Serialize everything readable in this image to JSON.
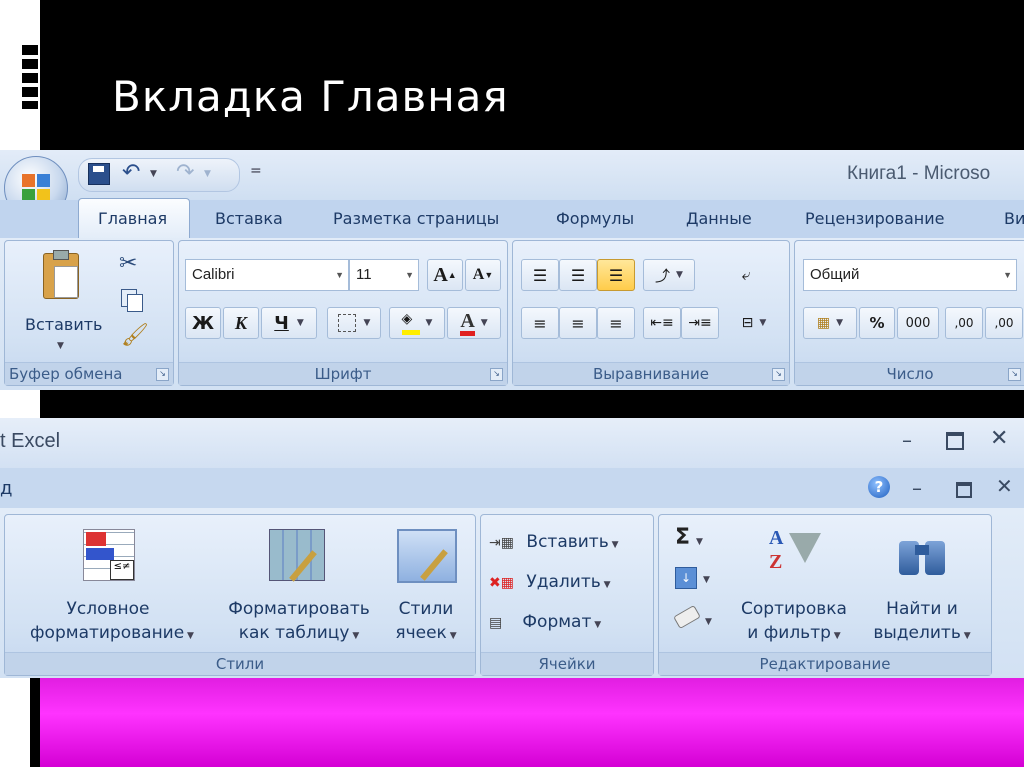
{
  "slide": {
    "title": "Вкладка Главная"
  },
  "window1": {
    "title": "Книга1 - Microso",
    "tabs": [
      "Главная",
      "Вставка",
      "Разметка страницы",
      "Формулы",
      "Данные",
      "Рецензирование",
      "Ви"
    ],
    "active_tab": "Главная",
    "groups": {
      "clipboard": {
        "label": "Буфер обмена",
        "paste": "Вставить"
      },
      "font": {
        "label": "Шрифт",
        "font_name": "Calibri",
        "font_size": "11",
        "bold": "Ж",
        "italic": "К",
        "underline": "Ч",
        "grow": "A",
        "shrink": "A",
        "font_color": "A"
      },
      "alignment": {
        "label": "Выравнивание"
      },
      "number": {
        "label": "Число",
        "format": "Общий",
        "percent": "%",
        "thousands": "000",
        "inc_decimal": ",00",
        "dec_decimal": ",00"
      }
    }
  },
  "window2": {
    "title": "t Excel",
    "tab_fragment": "д",
    "groups": {
      "styles": {
        "label": "Стили",
        "conditional": [
          "Условное",
          "форматирование"
        ],
        "as_table": [
          "Форматировать",
          "как таблицу"
        ],
        "cell_styles": [
          "Стили",
          "ячеек"
        ]
      },
      "cells": {
        "label": "Ячейки",
        "insert": "Вставить",
        "delete": "Удалить",
        "format": "Формат"
      },
      "editing": {
        "label": "Редактирование",
        "sum": "Σ",
        "sort": [
          "Сортировка",
          "и фильтр"
        ],
        "find": [
          "Найти и",
          "выделить"
        ]
      }
    }
  },
  "colors": {
    "magenta": "#ff33ff",
    "ribbon_blue": "#c6d9f0",
    "label_blue": "#3b5c89"
  }
}
